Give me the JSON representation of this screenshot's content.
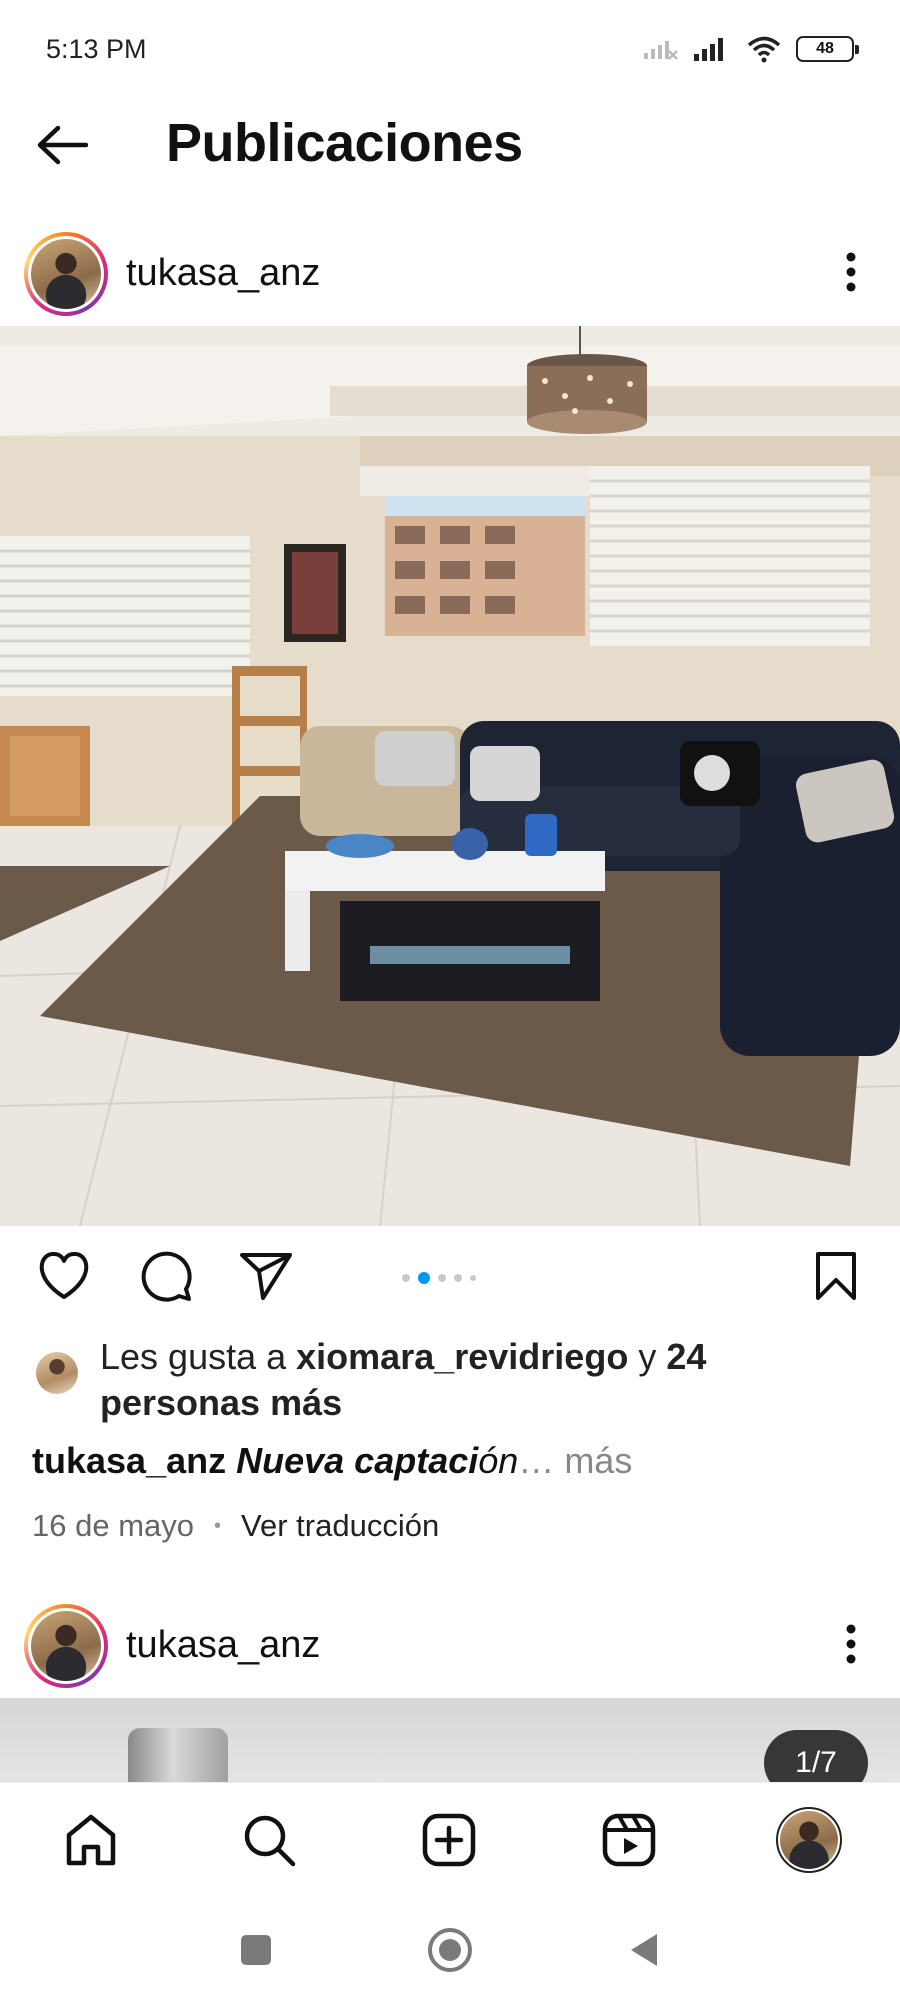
{
  "status_bar": {
    "time": "5:13 PM",
    "battery_level": "48",
    "icons": [
      "signal-off-icon",
      "signal-icon",
      "wifi-icon",
      "battery-icon"
    ]
  },
  "header": {
    "title": "Publicaciones",
    "back_icon": "back-arrow-icon"
  },
  "post": {
    "username": "tukasa_anz",
    "more_icon": "more-vertical-icon",
    "photo_icon": "living-room-photo",
    "carousel": {
      "count": 5,
      "active_index": 1
    },
    "actions": [
      "heart-icon",
      "comment-icon",
      "share-icon",
      "bookmark-icon"
    ],
    "likes": {
      "prefix": "Les gusta a",
      "liker": "xiomara_revidriego",
      "middle": "y",
      "others": "24 personas más"
    },
    "caption": {
      "username": "tukasa_anz",
      "text_bold": "Nueva captaci",
      "text_rest": "ón",
      "ellipsis": "…",
      "more": "más"
    },
    "date": "16 de mayo",
    "separator": "•",
    "translate": "Ver traducción"
  },
  "next_post": {
    "username": "tukasa_anz",
    "counter": "1/7"
  },
  "bottom_nav": {
    "items": [
      "home-icon",
      "search-icon",
      "create-icon",
      "reels-icon",
      "profile-avatar"
    ]
  },
  "system_nav": {
    "items": [
      "recents-icon",
      "home-circle-icon",
      "back-triangle-icon"
    ]
  },
  "colors": {
    "accent_blue": "#0095f6",
    "text": "#111111",
    "muted": "#888888"
  }
}
